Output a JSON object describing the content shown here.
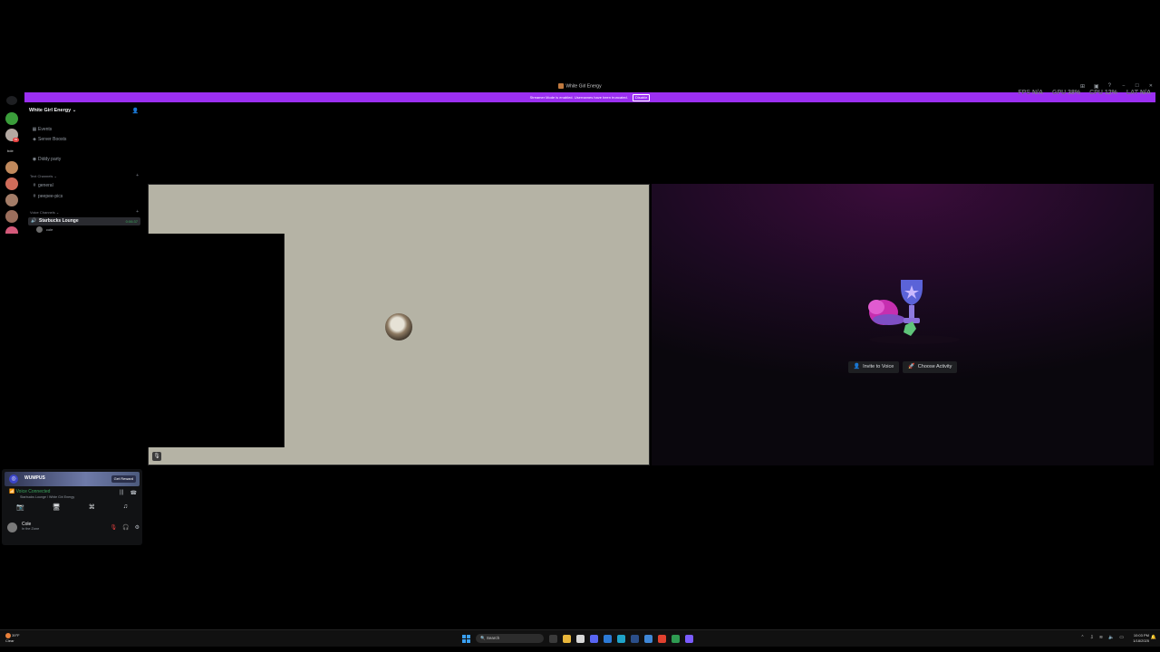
{
  "window": {
    "title": "White Girl Energy",
    "controls": [
      "–",
      "☐",
      "✕"
    ]
  },
  "banner": {
    "message": "Streamer Mode is enabled. Usernames have been truncated.",
    "disable_label": "Disable"
  },
  "perf": {
    "fps_label": "FPS",
    "fps_value": "N/A",
    "gpu_label": "GPU",
    "gpu_value": "38%",
    "cpu_label": "CPU",
    "cpu_value": "12%",
    "lat_label": "LAT",
    "lat_value": "N/A"
  },
  "rail": {
    "home_badge": "",
    "badge_1": "69",
    "label_1": "bde"
  },
  "sidebar": {
    "server_name": "White Girl Energy",
    "events": "Events",
    "boosts": "Server Boosts",
    "diddy": "Diddy party",
    "text_category": "Text Channels",
    "general": "general",
    "peepee": "peepee-pics",
    "voice_category": "Voice Channels",
    "active_channel": "Starbucks Lounge",
    "active_time": "0:06:37",
    "vc_user": "cole"
  },
  "stage": {
    "invite_label": "Invite to Voice",
    "activity_label": "Choose Activity"
  },
  "panel": {
    "nitro_word": "WUMPUS",
    "get_label": "Get Reward",
    "vc_status": "Voice Connected",
    "vc_sub": "Starbucks Lounge / White Girl Energy",
    "user_name": "Cole",
    "user_status": "In the Zone"
  },
  "taskbar": {
    "temp": "39°F",
    "weather": "Clear",
    "search": "Search",
    "time": "10:03 PM",
    "date": "1/18/2025"
  }
}
